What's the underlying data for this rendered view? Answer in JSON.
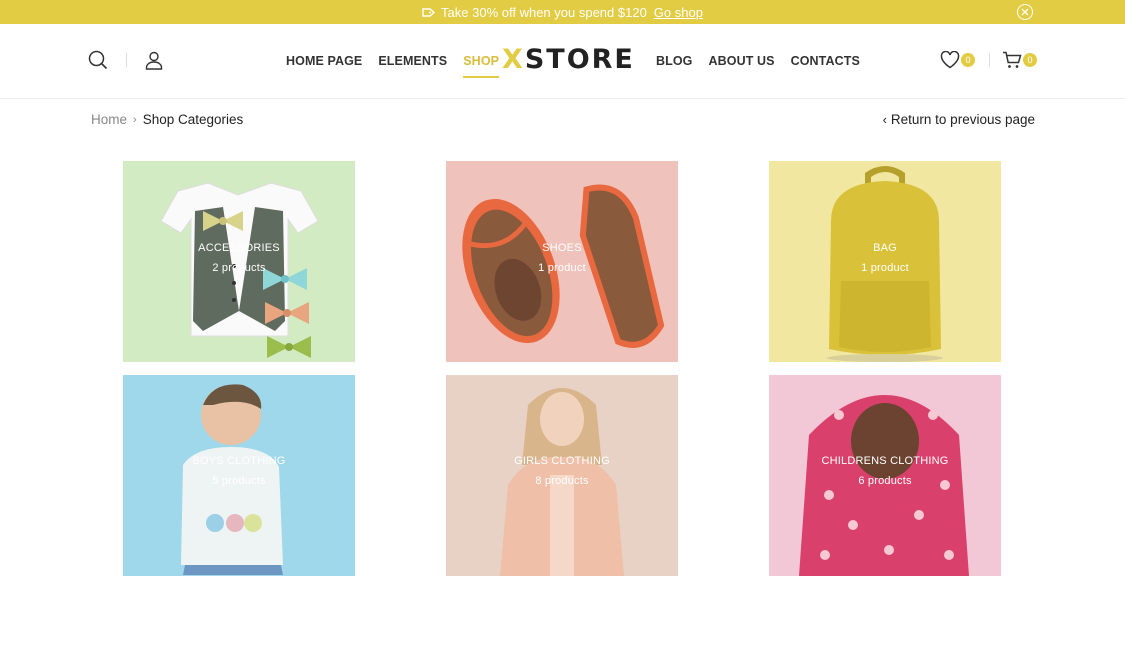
{
  "promo": {
    "text": "Take 30% off when you spend $120",
    "link": "Go shop"
  },
  "header": {
    "logo_x": "X",
    "logo_rest": "STORE",
    "nav_left": [
      "HOME PAGE",
      "ELEMENTS",
      "SHOP"
    ],
    "nav_right": [
      "BLOG",
      "ABOUT US",
      "CONTACTS"
    ],
    "active": "SHOP",
    "wishlist_count": "0",
    "cart_count": "0"
  },
  "breadcrumb": {
    "home": "Home",
    "current": "Shop Categories",
    "back": "Return to previous page"
  },
  "categories": [
    {
      "name": "ACCESSORIES",
      "count": "2 products",
      "bg": "#d3ebc3"
    },
    {
      "name": "SHOES",
      "count": "1 product",
      "bg": "#efc3bb"
    },
    {
      "name": "BAG",
      "count": "1 product",
      "bg": "#f2e7a1"
    },
    {
      "name": "BOYS CLOTHING",
      "count": "5 products",
      "bg": "#9ed8ea"
    },
    {
      "name": "GIRLS CLOTHING",
      "count": "8 products",
      "bg": "#e8d2c6"
    },
    {
      "name": "CHILDRENS CLOTHING",
      "count": "6 products",
      "bg": "#f2c7d6"
    }
  ],
  "colors": {
    "accent": "#e2cc43",
    "text": "#222222",
    "muted": "#888888"
  }
}
